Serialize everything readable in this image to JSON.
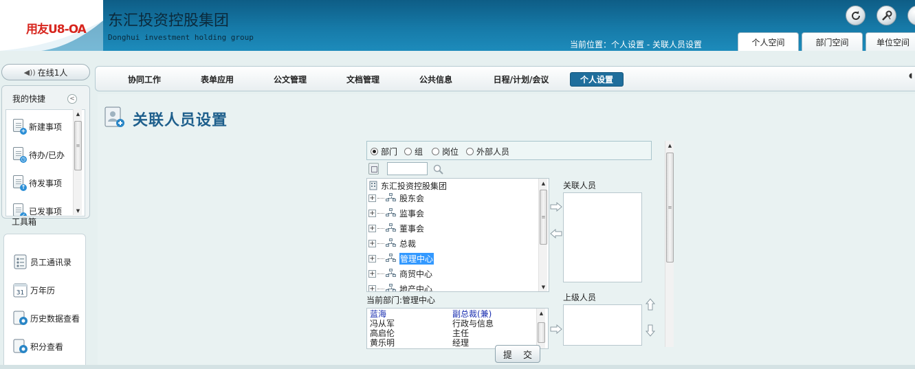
{
  "header": {
    "logo": "用友U8-OA",
    "company_name": "东汇投资控股集团",
    "company_en": "Donghui investment holding group",
    "breadcrumb": "当前位置：个人设置 - 关联人员设置",
    "icons": [
      "refresh-icon",
      "tools-icon",
      "user-icon"
    ],
    "tabs": [
      {
        "label": "个人空间",
        "active": true
      },
      {
        "label": "部门空间",
        "active": false
      },
      {
        "label": "单位空间",
        "active": false
      }
    ]
  },
  "sidebar": {
    "online": "在线1人",
    "quick_title": "我的快捷",
    "quick_items": [
      {
        "label": "新建事项",
        "icon": "doc-add-icon"
      },
      {
        "label": "待办/已办",
        "icon": "doc-clock-icon"
      },
      {
        "label": "待发事项",
        "icon": "doc-send-icon"
      },
      {
        "label": "已发事项",
        "icon": "doc-sent-icon"
      }
    ],
    "toolbox_title": "工具箱",
    "tools": [
      {
        "label": "员工通讯录",
        "icon": "address-book-icon"
      },
      {
        "label": "万年历",
        "icon": "calendar-icon",
        "calendar_day": "31"
      },
      {
        "label": "历史数据查看",
        "icon": "history-icon"
      },
      {
        "label": "积分查看",
        "icon": "points-icon"
      }
    ]
  },
  "nav": {
    "items": [
      {
        "label": "协同工作",
        "active": false
      },
      {
        "label": "表单应用",
        "active": false
      },
      {
        "label": "公文管理",
        "active": false
      },
      {
        "label": "文档管理",
        "active": false
      },
      {
        "label": "公共信息",
        "active": false
      },
      {
        "label": "日程/计划/会议",
        "active": false
      },
      {
        "label": "个人设置",
        "active": true
      }
    ]
  },
  "page": {
    "title": "关联人员设置"
  },
  "selector": {
    "radios": [
      {
        "label": "部门",
        "checked": true
      },
      {
        "label": "组",
        "checked": false
      },
      {
        "label": "岗位",
        "checked": false
      },
      {
        "label": "外部人员",
        "checked": false
      }
    ],
    "search_value": "",
    "tree_root": "东汇投资控股集团",
    "tree_nodes": [
      {
        "label": "股东会",
        "selected": false
      },
      {
        "label": "监事会",
        "selected": false
      },
      {
        "label": "董事会",
        "selected": false
      },
      {
        "label": "总裁",
        "selected": false
      },
      {
        "label": "管理中心",
        "selected": true
      },
      {
        "label": "商贸中心",
        "selected": false
      },
      {
        "label": "地产中心",
        "selected": false
      }
    ],
    "current_dept": "当前部门:管理中心",
    "members": [
      {
        "name": "蓝海",
        "position": "副总裁(兼)",
        "highlight": true
      },
      {
        "name": "冯从军",
        "position": "行政与信息",
        "highlight": false
      },
      {
        "name": "高启伦",
        "position": "主任",
        "highlight": false
      },
      {
        "name": "黄乐明",
        "position": "经理",
        "highlight": false
      }
    ],
    "related_label": "关联人员",
    "superior_label": "上级人员",
    "submit_label": "提 交"
  }
}
